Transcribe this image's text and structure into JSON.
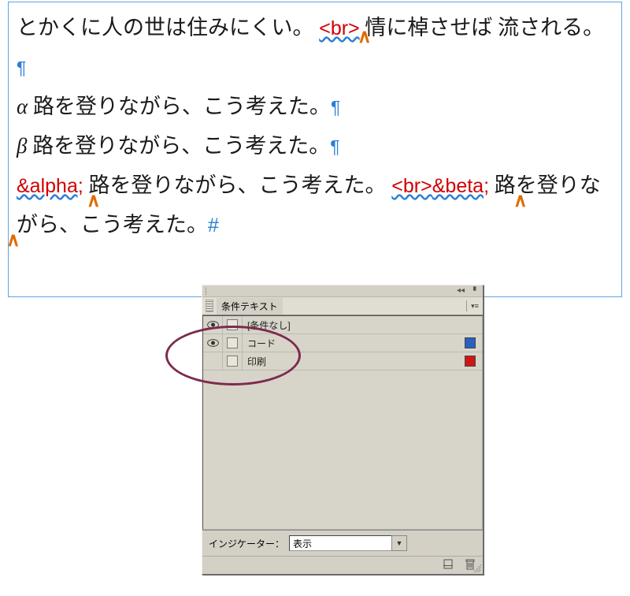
{
  "text": {
    "line1a": "とかくに人の世は住みにくい。",
    "br": "<br>",
    "line1b": "情に棹させば",
    "line1c": "流される。",
    "pilcrow": "¶",
    "alpha": "α",
    "alpha_text": " 路を登りながら、こう考えた。",
    "beta": "β",
    "beta_text": " 路を登りながら、こう考えた。",
    "alpha_entity": "&alpha;",
    "line4": " 路を登りながら、こう考えた。",
    "beta_entity": "&beta;",
    "line5": "路を登りながら、こう考えた。",
    "pound": "#"
  },
  "panel": {
    "tab": "条件テキスト",
    "rows": [
      {
        "label": "[条件なし]",
        "eye": true,
        "swatch": null
      },
      {
        "label": "コード",
        "eye": true,
        "swatch": "#2a5fc2"
      },
      {
        "label": "印刷",
        "eye": false,
        "swatch": "#d11515"
      }
    ],
    "indicator_label": "インジケーター：",
    "indicator_value": "表示"
  }
}
